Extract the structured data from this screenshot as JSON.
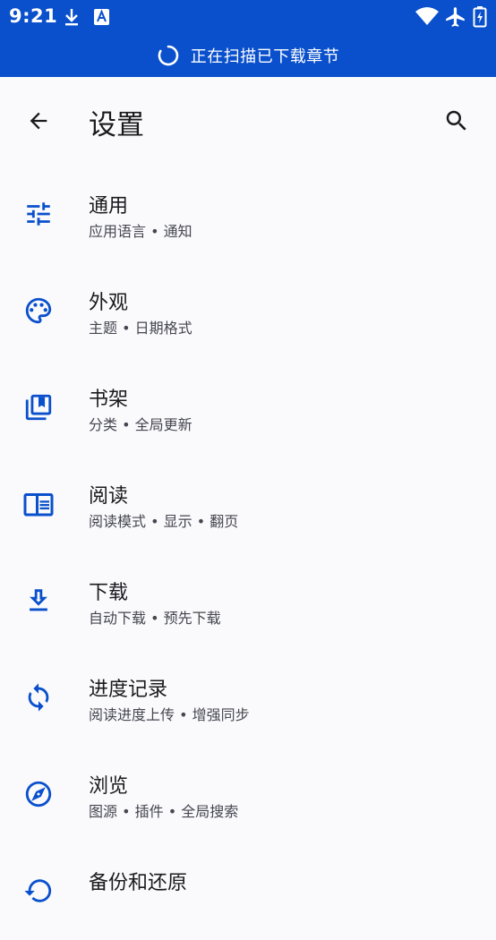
{
  "status_bar": {
    "time": "9:21"
  },
  "banner": {
    "text": "正在扫描已下载章节"
  },
  "toolbar": {
    "title": "设置"
  },
  "settings": [
    {
      "title": "通用",
      "subtitle": "应用语言 • 通知",
      "icon": "tune-icon"
    },
    {
      "title": "外观",
      "subtitle": "主题 • 日期格式",
      "icon": "palette-icon"
    },
    {
      "title": "书架",
      "subtitle": "分类 • 全局更新",
      "icon": "library-icon"
    },
    {
      "title": "阅读",
      "subtitle": "阅读模式 • 显示 • 翻页",
      "icon": "chrome-reader-icon"
    },
    {
      "title": "下载",
      "subtitle": "自动下载 • 预先下载",
      "icon": "download-icon"
    },
    {
      "title": "进度记录",
      "subtitle": "阅读进度上传 • 增强同步",
      "icon": "sync-icon"
    },
    {
      "title": "浏览",
      "subtitle": "图源 • 插件 • 全局搜索",
      "icon": "explore-icon"
    },
    {
      "title": "备份和还原",
      "subtitle": "",
      "icon": "backup-icon"
    }
  ],
  "colors": {
    "primary": "#0a50cc",
    "background": "#fafafd",
    "on_surface": "#1b1b1f",
    "on_surface_variant": "#45464f",
    "icon_tint": "#0a50cc"
  }
}
